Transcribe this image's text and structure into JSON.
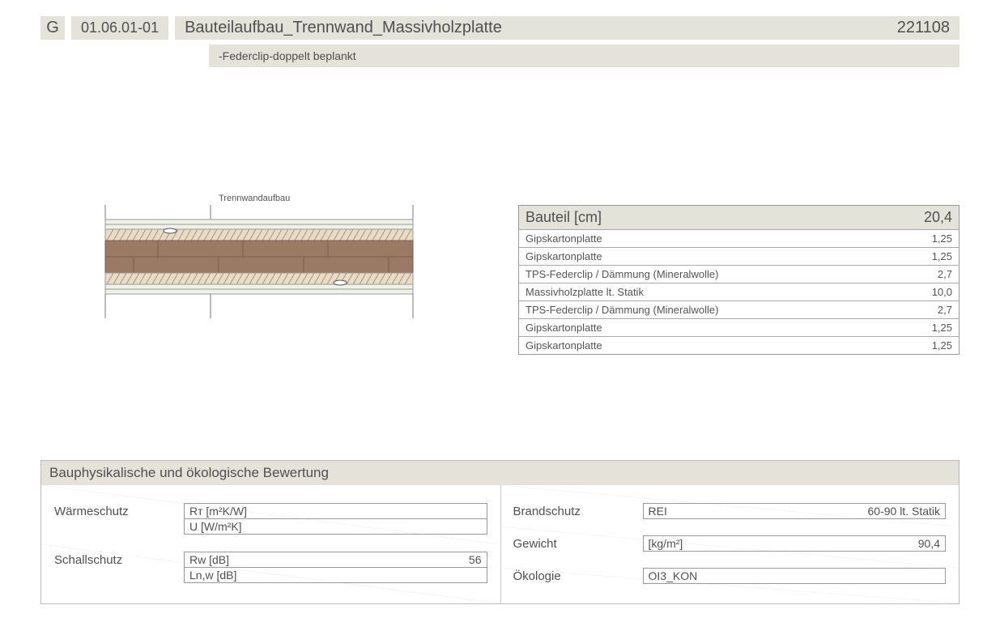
{
  "header": {
    "badge": "G",
    "code": "01.06.01-01",
    "title": "Bauteilaufbau_Trennwand_Massivholzplatte",
    "date": "221108",
    "subtitle": "-Federclip-doppelt beplankt"
  },
  "drawing": {
    "label": "Trennwandaufbau"
  },
  "layers": {
    "header_label": "Bauteil [cm]",
    "header_total": "20,4",
    "rows": [
      {
        "name": "Gipskartonplatte",
        "value": "1,25"
      },
      {
        "name": "Gipskartonplatte",
        "value": "1,25"
      },
      {
        "name": "TPS-Federclip / Dämmung (Mineralwolle)",
        "value": "2,7"
      },
      {
        "name": "Massivholzplatte lt. Statik",
        "value": "10,0"
      },
      {
        "name": "TPS-Federclip / Dämmung (Mineralwolle)",
        "value": "2,7"
      },
      {
        "name": "Gipskartonplatte",
        "value": "1,25"
      },
      {
        "name": "Gipskartonplatte",
        "value": "1,25"
      }
    ]
  },
  "eval": {
    "title": "Bauphysikalische und ökologische Bewertung",
    "left": {
      "waermeschutz": {
        "label": "Wärmeschutz",
        "fields": [
          {
            "key": "Rᴛ [m²K/W]",
            "val": ""
          },
          {
            "key": "U [W/m²K]",
            "val": ""
          }
        ]
      },
      "schallschutz": {
        "label": "Schallschutz",
        "fields": [
          {
            "key": "Rw [dB]",
            "val": "56"
          },
          {
            "key": "Ln,w [dB]",
            "val": ""
          }
        ]
      }
    },
    "right": {
      "brandschutz": {
        "label": "Brandschutz",
        "fields": [
          {
            "key": "REI",
            "val": "60-90 lt. Statik"
          }
        ]
      },
      "gewicht": {
        "label": "Gewicht",
        "fields": [
          {
            "key": "[kg/m²]",
            "val": "90,4"
          }
        ]
      },
      "oekologie": {
        "label": "Ökologie",
        "fields": [
          {
            "key": "OI3_KON",
            "val": ""
          }
        ]
      }
    }
  }
}
